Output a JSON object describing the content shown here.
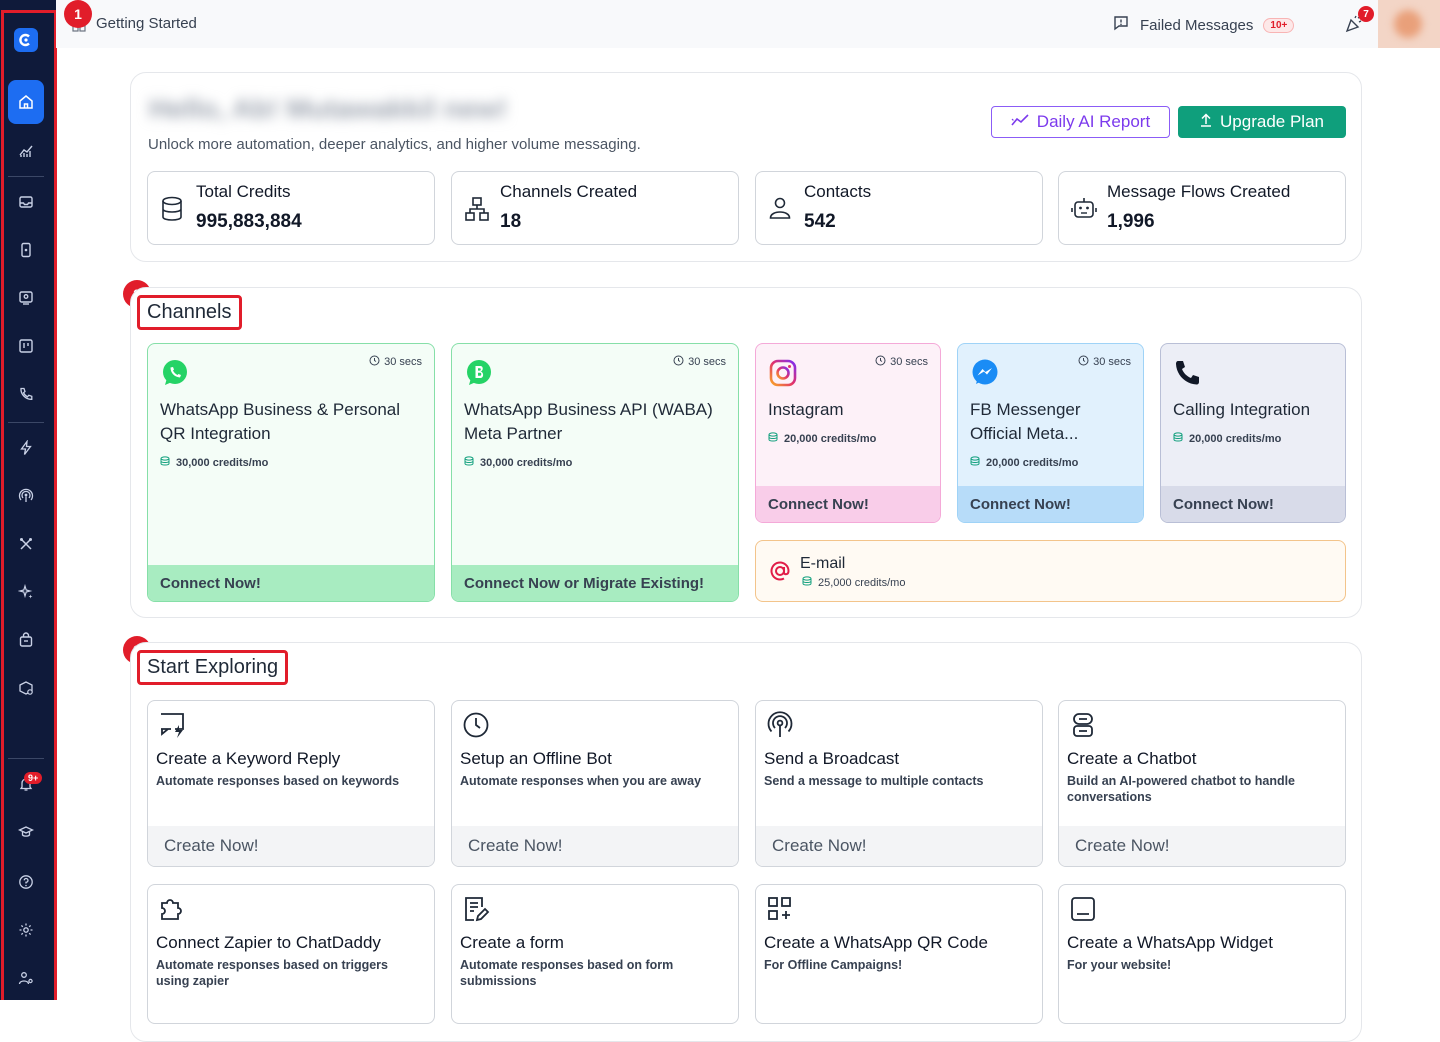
{
  "topbar": {
    "title": "Getting Started",
    "failed_label": "Failed Messages",
    "failed_count": "10+",
    "notification_count": "7"
  },
  "sidebar": {
    "alerts_badge": "9+"
  },
  "markers": [
    "1",
    "2",
    "3"
  ],
  "hero": {
    "greeting": "Hello, Ab! Mutawakkil new!",
    "subtitle": "Unlock more automation, deeper analytics, and higher volume messaging.",
    "report_label": "Daily AI Report",
    "upgrade_label": "Upgrade Plan",
    "stats": [
      {
        "label": "Total Credits",
        "value": "995,883,884",
        "icon": "database-icon"
      },
      {
        "label": "Channels Created",
        "value": "18",
        "icon": "sitemap-icon"
      },
      {
        "label": "Contacts",
        "value": "542",
        "icon": "user-icon"
      },
      {
        "label": "Message Flows Created",
        "value": "1,996",
        "icon": "robot-icon"
      }
    ]
  },
  "channels": {
    "title": "Channels",
    "items": [
      {
        "name_line1": "WhatsApp Business & Personal",
        "name_line2": "QR Integration",
        "time": "30 secs",
        "credits": "30,000 credits/mo",
        "cta": "Connect Now!"
      },
      {
        "name_line1": "WhatsApp Business API (WABA)",
        "name_line2": "Meta Partner",
        "time": "30 secs",
        "credits": "30,000 credits/mo",
        "cta": "Connect Now or Migrate Existing!"
      },
      {
        "name_line1": "Instagram",
        "name_line2": "",
        "time": "30 secs",
        "credits": "20,000 credits/mo",
        "cta": "Connect Now!"
      },
      {
        "name_line1": "FB Messenger",
        "name_line2": "Official Meta...",
        "time": "30 secs",
        "credits": "20,000 credits/mo",
        "cta": "Connect Now!"
      },
      {
        "name_line1": "Calling Integration",
        "name_line2": "",
        "time": "",
        "credits": "20,000 credits/mo",
        "cta": "Connect Now!"
      }
    ],
    "email": {
      "name": "E-mail",
      "credits": "25,000 credits/mo"
    }
  },
  "explore": {
    "title": "Start Exploring",
    "items": [
      {
        "title": "Create a Keyword Reply",
        "desc": "Automate responses based on keywords",
        "cta": "Create Now!"
      },
      {
        "title": "Setup an Offline Bot",
        "desc": "Automate responses when you are away",
        "cta": "Create Now!"
      },
      {
        "title": "Send a Broadcast",
        "desc": "Send a message to multiple contacts",
        "cta": "Create Now!"
      },
      {
        "title": "Create a Chatbot",
        "desc": "Build an AI-powered chatbot to handle conversations",
        "cta": "Create Now!"
      },
      {
        "title": "Connect Zapier to ChatDaddy",
        "desc": "Automate responses based on triggers using zapier"
      },
      {
        "title": "Create a form",
        "desc": "Automate responses based on form submissions"
      },
      {
        "title": "Create a WhatsApp QR Code",
        "desc": "For Offline Campaigns!"
      },
      {
        "title": "Create a WhatsApp Widget",
        "desc": "For your website!"
      }
    ]
  },
  "colors": {
    "sidebar": "#0f1a3a",
    "accent": "#1d6df2",
    "upgrade": "#0f9f7c",
    "report": "#7c3aed",
    "callout": "#e11d2a"
  }
}
